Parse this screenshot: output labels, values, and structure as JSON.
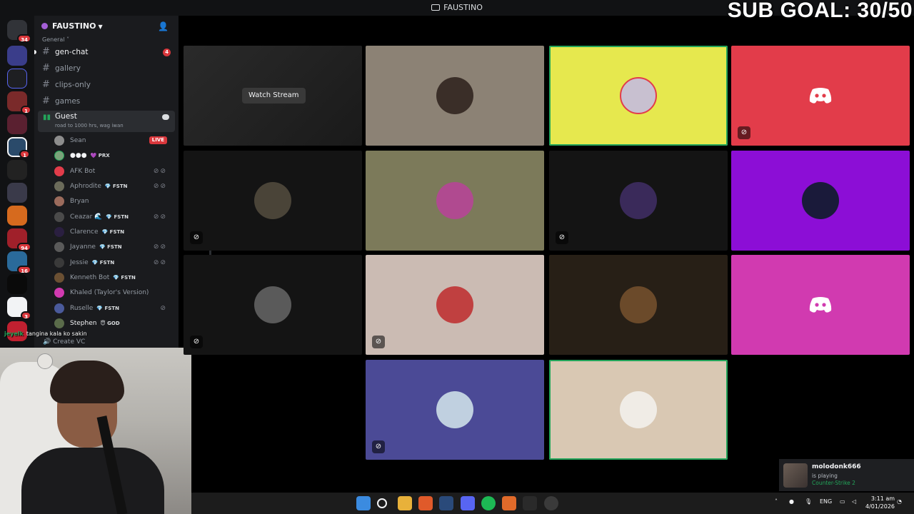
{
  "window": {
    "title": "FAUSTINO"
  },
  "stream_overlay": {
    "sub_goal": "SUB GOAL: 30/50",
    "chat_user": "jeyelk",
    "chat_message": "tangina kala ko sakin"
  },
  "rail": {
    "badges": [
      "34",
      "1",
      "1",
      "4",
      "94",
      "16",
      "3"
    ]
  },
  "sidebar": {
    "server_name": "FAUSTINO",
    "category": "General",
    "channels": [
      {
        "name": "gen-chat",
        "badge": "4"
      },
      {
        "name": "gallery"
      },
      {
        "name": "clips-only"
      },
      {
        "name": "games"
      }
    ],
    "voice_channel": {
      "name": "Guest",
      "status": "road to 1000 hrs, wag iwan"
    },
    "members": [
      {
        "name": "Sean",
        "tag": "",
        "live": "LIVE",
        "color": "#8d8d8d"
      },
      {
        "name": "●●●",
        "tag": "💜 PRX",
        "color": "#7aa37a"
      },
      {
        "name": "AFK Bot",
        "tag": "",
        "color": "#e23c4a"
      },
      {
        "name": "Aphrodite",
        "tag": "💎 FSTN",
        "color": "#6b6b5a"
      },
      {
        "name": "Bryan",
        "tag": "",
        "color": "#9b6b5c"
      },
      {
        "name": "Ceazar 🌊",
        "tag": "💎 FSTN",
        "color": "#4a4a4a"
      },
      {
        "name": "Clarence",
        "tag": "💎 FSTN",
        "color": "#2a1f40"
      },
      {
        "name": "Jayanne",
        "tag": "💎 FSTN",
        "color": "#5a5a5a"
      },
      {
        "name": "Jessie",
        "tag": "💎 FSTN",
        "color": "#3a3a3a"
      },
      {
        "name": "Kenneth Bot",
        "tag": "💎 FSTN",
        "color": "#6b5033"
      },
      {
        "name": "Khaled (Taylor's Version)",
        "tag": "",
        "color": "#d13ab0"
      },
      {
        "name": "Ruselle",
        "tag": "💎 FSTN",
        "color": "#4a5a9b"
      },
      {
        "name": "Stephen",
        "tag": "😇 GOD",
        "color": "#5a6b4a"
      }
    ],
    "create_vc": "Create VC"
  },
  "grid": {
    "watch_stream": "Watch Stream",
    "tile_colors": [
      "#1c1c1c",
      "#8c8275",
      "#e6e84e",
      "#e23c4a",
      "#141414",
      "#7c7a5a",
      "#141414",
      "#8c0ed6",
      "#141414",
      "#cbbbb3",
      "#271f16",
      "#d13ab0",
      "#4b4a96",
      "#d9c8b3"
    ]
  },
  "notification": {
    "user": "molodonk666",
    "line": "is playing",
    "game": "Counter-Strike 2"
  },
  "taskbar": {
    "lang": "ENG",
    "time": "3:11 am",
    "date": "4/01/2026"
  }
}
